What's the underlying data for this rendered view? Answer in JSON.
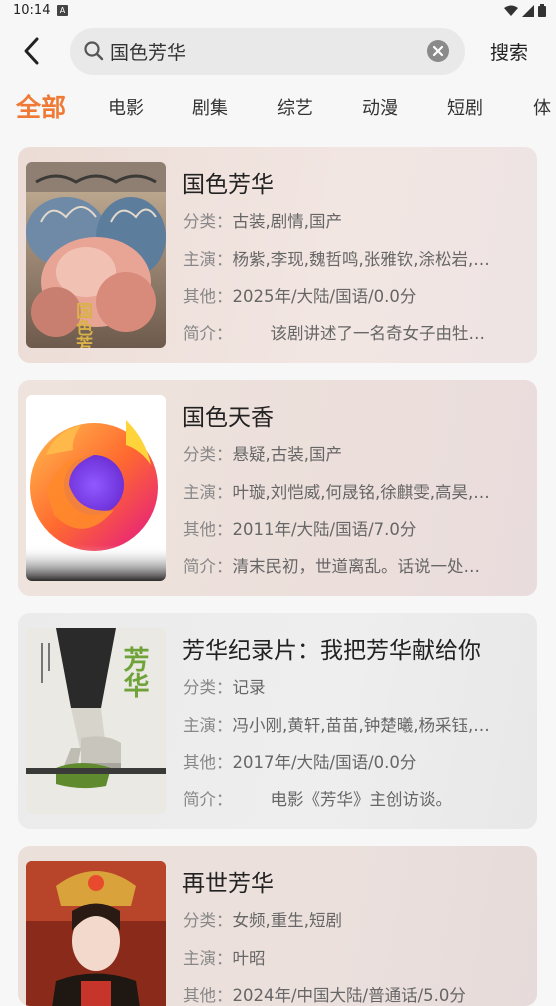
{
  "status_bar": {
    "time": "10:14",
    "notif_letter": "A"
  },
  "search": {
    "value": "国色芳华",
    "button_label": "搜索"
  },
  "tabs": [
    {
      "label": "全部",
      "active": true
    },
    {
      "label": "电影"
    },
    {
      "label": "剧集"
    },
    {
      "label": "综艺"
    },
    {
      "label": "动漫"
    },
    {
      "label": "短剧"
    },
    {
      "label": "体"
    }
  ],
  "labels": {
    "category": "分类：",
    "cast": "主演：",
    "other": "其他：",
    "intro": "简介："
  },
  "results": [
    {
      "title": "国色芳华",
      "category": "古装,剧情,国产",
      "cast": "杨紫,李现,魏哲鸣,张雅钦,涂松岩,…",
      "other": "2025年/大陆/国语/0.0分",
      "intro": "该剧讲述了一名奇女子由牡…",
      "poster_icon": "peony-poster-art",
      "poster_title_art": "国色芳华"
    },
    {
      "title": "国色天香",
      "category": "悬疑,古装,国产",
      "cast": "叶璇,刘恺威,何晟铭,徐麒雯,高昊,…",
      "other": "2011年/大陆/国语/7.0分",
      "intro": "清末民初，世道离乱。话说一处…",
      "poster_icon": "firefox-logo-placeholder"
    },
    {
      "title": "芳华纪录片：我把芳华献给你",
      "category": "记录",
      "cast": "冯小刚,黄轩,苗苗,钟楚曦,杨采钰,…",
      "other": "2017年/大陆/国语/0.0分",
      "intro": "电影《芳华》主创访谈。",
      "poster_icon": "ballet-shoes-poster",
      "poster_title_art": "芳华"
    },
    {
      "title": "再世芳华",
      "category": "女频,重生,短剧",
      "cast": "叶昭",
      "other": "2024年/中国大陆/普通话/5.0分",
      "intro": "",
      "poster_icon": "actress-in-headdress-poster"
    }
  ],
  "colors": {
    "accent": "#ef7a35",
    "background": "#f7f7f7"
  }
}
